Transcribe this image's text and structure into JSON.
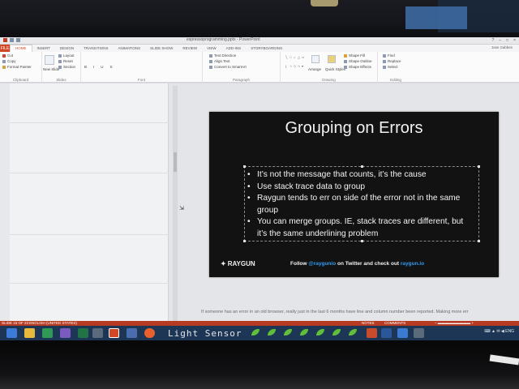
{
  "window": {
    "title": "espressoprogramming.pptx - PowerPoint",
    "qat": [
      "save-icon",
      "undo-icon",
      "redo-icon"
    ],
    "controls": [
      "?",
      "–",
      "□",
      "×"
    ]
  },
  "ribbon": {
    "file_tab": "FILE",
    "tabs": [
      "HOME",
      "INSERT",
      "DESIGN",
      "TRANSITIONS",
      "ANIMATIONS",
      "SLIDE SHOW",
      "REVIEW",
      "VIEW",
      "ADD-INS",
      "STORYBOARDING"
    ],
    "active_tab": "HOME",
    "user": "Jase Sabbes",
    "clipboard": {
      "paste": "Paste",
      "cut": "Cut",
      "copy": "Copy",
      "format_painter": "Format Painter",
      "name": "Clipboard"
    },
    "slides": {
      "new_slide": "New Slide",
      "layout": "Layout",
      "reset": "Reset",
      "section": "Section",
      "name": "Slides"
    },
    "font": {
      "bold": "B",
      "italic": "I",
      "underline": "U",
      "strike": "S",
      "name": "Font"
    },
    "paragraph": {
      "text_direction": "Text Direction",
      "align_text": "Align Text",
      "smartart": "Convert to SmartArt",
      "name": "Paragraph"
    },
    "drawing": {
      "arrange": "Arrange",
      "quick_styles": "Quick Styles",
      "shape_fill": "Shape Fill",
      "shape_outline": "Shape Outline",
      "shape_effects": "Shape Effects",
      "name": "Drawing"
    },
    "editing": {
      "find": "Find",
      "replace": "Replace",
      "select": "Select",
      "name": "Editing"
    }
  },
  "slide": {
    "title": "Grouping on Errors",
    "bullets": [
      "It’s not the message that counts, it’s the cause",
      "Use stack trace data to group",
      "Raygun tends to err on side of the error not in the same group",
      "You can merge groups. IE, stack traces are different, but it’s the same underlining problem"
    ],
    "logo": "RAYGUN",
    "footer_prefix": "Follow ",
    "footer_handle": "@raygunio",
    "footer_mid": " on Twitter and check out ",
    "footer_link": "raygun.io"
  },
  "notes": {
    "text": "If someone has an error in an old browser, really just in the last 6 months have line and column number been reported. Making more err"
  },
  "statusbar": {
    "slide_count": "SLIDE 15 OF 23",
    "language": "ENGLISH (UNITED STATES)",
    "notes": "NOTES",
    "comments": "COMMENTS"
  },
  "taskbar": {
    "label": "Light Sensor",
    "tray_time": "ENG"
  },
  "colors": {
    "accent": "#d24726",
    "slide_bg": "#121213",
    "link": "#2f9cf0",
    "taskbar": "#1e3656"
  }
}
